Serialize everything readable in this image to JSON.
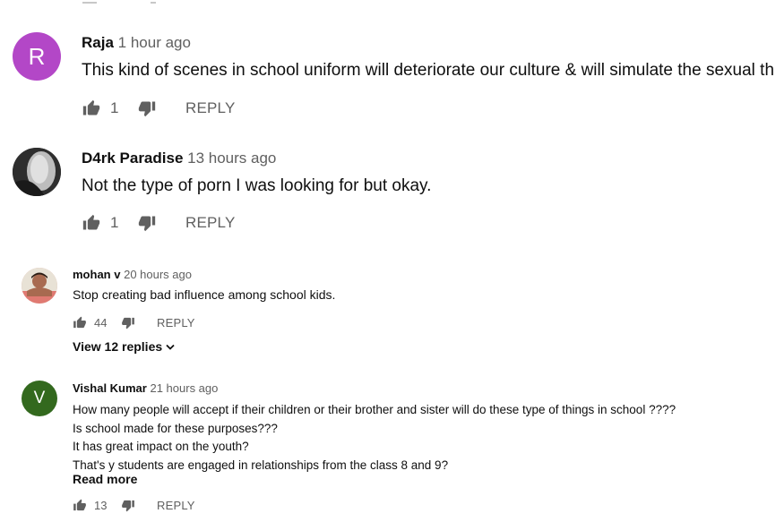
{
  "comments": [
    {
      "author": "Raja",
      "time": "1 hour ago",
      "avatar_letter": "R",
      "avatar_color": "#b347c7",
      "lines": [
        "This kind of scenes in school uniform will deteriorate our culture & will simulate the sexual th"
      ],
      "likes": "1",
      "reply_label": "REPLY"
    },
    {
      "author": "D4rk Paradise",
      "time": "13 hours ago",
      "avatar_color": "#3a3a3a",
      "lines": [
        "Not the type of porn I was looking for but okay."
      ],
      "likes": "1",
      "reply_label": "REPLY"
    },
    {
      "author": "mohan v",
      "time": "20 hours ago",
      "avatar_color": "#d99a8a",
      "lines": [
        "Stop creating bad influence among school kids."
      ],
      "likes": "44",
      "reply_label": "REPLY",
      "view_replies": "View 12 replies"
    },
    {
      "author": "Vishal Kumar",
      "time": "21 hours ago",
      "avatar_letter": "V",
      "avatar_color": "#33691e",
      "lines": [
        "How many  people will accept  if their  children or their brother and sister will do these type of things in school ????",
        "Is school made for these purposes???",
        "It has great impact on the youth?",
        "That's y students are engaged in relationships from the class 8 and 9?"
      ],
      "read_more": "Read more",
      "likes": "13",
      "reply_label": "REPLY"
    }
  ]
}
